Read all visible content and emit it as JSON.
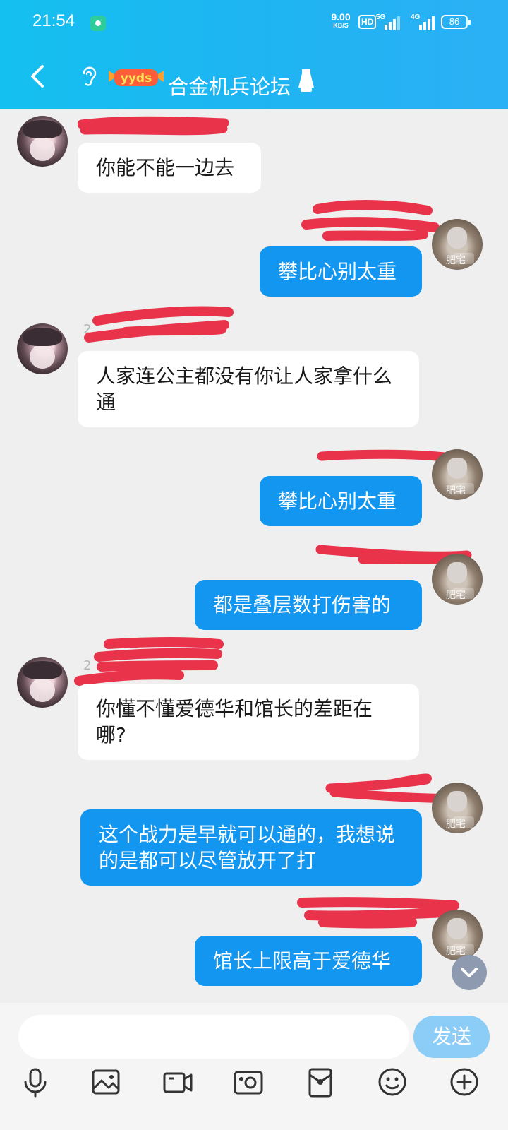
{
  "status_bar": {
    "time": "21:54",
    "net_speed": "9.00",
    "net_unit": "KB/S",
    "hd_label": "HD",
    "sim1_label": "5G",
    "sim2_label": "4G",
    "battery": "86"
  },
  "header": {
    "title": "合金机兵论坛",
    "badge_text": "yyds"
  },
  "messages": [
    {
      "side": "in",
      "text": "你能不能一边去"
    },
    {
      "side": "out",
      "text": "攀比心别太重",
      "avatar_text": "肥宅"
    },
    {
      "side": "in",
      "text": "人家连公主都没有你让人家拿什么通"
    },
    {
      "side": "out",
      "text": "攀比心别太重",
      "avatar_text": "肥宅"
    },
    {
      "side": "out",
      "text": "都是叠层数打伤害的",
      "avatar_text": "肥宅"
    },
    {
      "side": "in",
      "text": "你懂不懂爱德华和馆长的差距在哪?"
    },
    {
      "side": "out",
      "text": "这个战力是早就可以通的，我想说的是都可以尽管放开了打",
      "avatar_text": "肥宅"
    },
    {
      "side": "out",
      "text": "馆长上限高于爱德华",
      "avatar_text": "肥宅"
    }
  ],
  "input": {
    "placeholder": "",
    "send_label": "发送"
  },
  "toolbar_icons": [
    "mic-icon",
    "image-icon",
    "video-icon",
    "camera-icon",
    "red-packet-icon",
    "emoji-icon",
    "plus-icon"
  ],
  "colors": {
    "header": "#1fb4f2",
    "bubble_out": "#1296f0",
    "redaction": "#e8334a",
    "send_button": "#8ccdf7"
  }
}
